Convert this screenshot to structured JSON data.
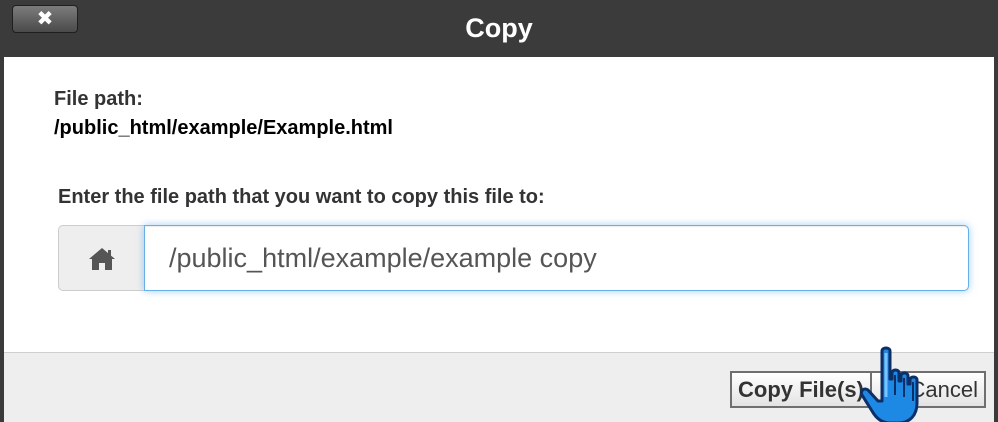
{
  "dialog": {
    "title": "Copy",
    "close_label": "✖"
  },
  "file": {
    "label": "File path:",
    "path": "/public_html/example/Example.html"
  },
  "destination": {
    "prompt": "Enter the file path that you want to copy this file to:",
    "home_icon": "home-icon",
    "value": "/public_html/example/example copy"
  },
  "footer": {
    "copy_label": "Copy File(s)",
    "cancel_label": "Cancel"
  },
  "colors": {
    "titlebar": "#3b3b3b",
    "focus_border": "#66afe9",
    "cursor": "#1e88e5"
  }
}
